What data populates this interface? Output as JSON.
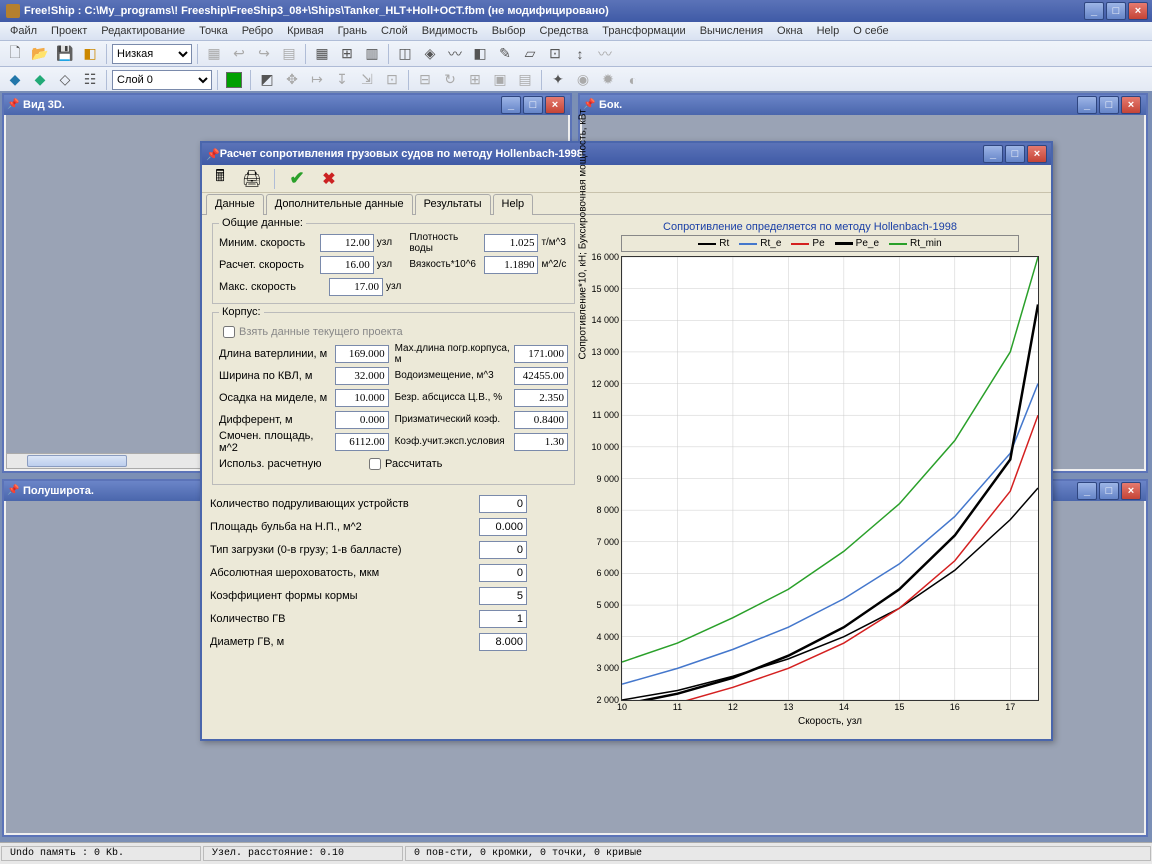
{
  "app": {
    "title": "Free!Ship  : C:\\My_programs\\! Freeship\\FreeShip3_08+\\Ships\\Tanker_HLT+Holl+OCT.fbm (не модифицировано)"
  },
  "menu": [
    "Файл",
    "Проект",
    "Редактирование",
    "Точка",
    "Ребро",
    "Кривая",
    "Грань",
    "Слой",
    "Видимость",
    "Выбор",
    "Средства",
    "Трансформации",
    "Вычисления",
    "Окна",
    "Help",
    "О себе"
  ],
  "toolbar_selects": {
    "quality": "Низкая",
    "layer": "Слой 0"
  },
  "child_windows": {
    "view3d": "Вид 3D.",
    "bok": "Бок.",
    "polushirota": "Полуширота."
  },
  "dialog": {
    "title": "Расчет сопротивления грузовых судов по методу Hollenbach-1998",
    "tabs": [
      "Данные",
      "Дополнительные данные",
      "Результаты",
      "Help"
    ],
    "group_general": "Общие данные:",
    "group_hull": "Корпус:",
    "calc_from_project": "Взять данные текущего проекта",
    "general": {
      "min_speed_label": "Миним. скорость",
      "min_speed": "12.00",
      "uzl": "узл",
      "calc_speed_label": "Расчет. скорость",
      "calc_speed": "16.00",
      "max_speed_label": "Макс. скорость",
      "max_speed": "17.00",
      "density_label": "Плотность воды",
      "density": "1.025",
      "density_unit": "т/м^3",
      "viscosity_label": "Вязкость*10^6",
      "viscosity": "1.1890",
      "viscosity_unit": "м^2/с"
    },
    "hull": {
      "lwl_label": "Длина ватерлинии, м",
      "lwl": "169.000",
      "bwl_label": "Ширина по КВЛ, м",
      "bwl": "32.000",
      "draft_label": "Осадка на миделе, м",
      "draft": "10.000",
      "trim_label": "Дифферент, м",
      "trim": "0.000",
      "wsa_label": "Смочен. площадь, м^2",
      "wsa": "6112.00",
      "hull_max_label": "Мах.длина погр.корпуса, м",
      "hull_max": "171.000",
      "disp_label": "Водоизмещение, м^3",
      "disp": "42455.00",
      "abscissa_label": "Безр. абсцисса Ц.В., %",
      "abscissa": "2.350",
      "prismatic_label": "Призматический коэф.",
      "prismatic": "0.8400",
      "exploit_label": "Коэф.учит.эксп.условия",
      "exploit": "1.30",
      "use_calc_label": "Использ. расчетную",
      "recalc": "Рассчитать"
    },
    "extra": {
      "thrusters_label": "Количество подруливающих устройств",
      "thrusters": "0",
      "bulb_label": "Площадь бульба на Н.П., м^2",
      "bulb": "0.000",
      "load_label": "Тип загрузки (0-в грузу; 1-в балласте)",
      "load": "0",
      "roughness_label": "Абсолютная шероховатость, мкм",
      "roughness": "0",
      "stern_label": "Коэффициент формы кормы",
      "stern": "5",
      "nprop_label": "Количество ГВ",
      "nprop": "1",
      "dprop_label": "Диаметр ГВ, м",
      "dprop": "8.000"
    }
  },
  "chart_data": {
    "type": "line",
    "title": "Сопротивление определяется по методу Hollenbach-1998",
    "xlabel": "Скорость, узл",
    "ylabel": "Сопротивление*10, кН;  Буксировочная мощность, кВт",
    "xlim": [
      10,
      17.5
    ],
    "ylim": [
      2000,
      16000
    ],
    "xticks": [
      10,
      11,
      12,
      13,
      14,
      15,
      16,
      17
    ],
    "yticks": [
      2000,
      3000,
      4000,
      5000,
      6000,
      7000,
      8000,
      9000,
      10000,
      11000,
      12000,
      13000,
      14000,
      15000,
      16000
    ],
    "series": [
      {
        "name": "Rt",
        "color": "#000000",
        "x": [
          10,
          11,
          12,
          13,
          14,
          15,
          16,
          17,
          17.5
        ],
        "y": [
          2000,
          2300,
          2750,
          3300,
          4000,
          4900,
          6100,
          7700,
          8700
        ]
      },
      {
        "name": "Rt_e",
        "color": "#4477cc",
        "x": [
          10,
          11,
          12,
          13,
          14,
          15,
          16,
          17,
          17.5
        ],
        "y": [
          2500,
          3000,
          3600,
          4300,
          5200,
          6300,
          7800,
          9800,
          12000
        ]
      },
      {
        "name": "Pe",
        "color": "#d42020",
        "x": [
          10,
          11,
          12,
          13,
          14,
          15,
          16,
          17,
          17.5
        ],
        "y": [
          1600,
          1900,
          2400,
          3000,
          3800,
          4900,
          6400,
          8600,
          11000
        ]
      },
      {
        "name": "Pe_e",
        "color": "#000000",
        "thick": true,
        "x": [
          10,
          11,
          12,
          13,
          14,
          15,
          16,
          17,
          17.5
        ],
        "y": [
          1850,
          2200,
          2700,
          3400,
          4300,
          5500,
          7200,
          9600,
          14500
        ]
      },
      {
        "name": "Rt_min",
        "color": "#2aa02a",
        "x": [
          10,
          11,
          12,
          13,
          14,
          15,
          16,
          17,
          17.5
        ],
        "y": [
          3200,
          3800,
          4600,
          5500,
          6700,
          8200,
          10200,
          13000,
          16000
        ]
      }
    ]
  },
  "status": {
    "undo": "Undo память : 0 Kb.",
    "dist": "Узел. расстояние: 0.10",
    "counts": "0 пов-сти, 0 кромки, 0 точки, 0 кривые"
  }
}
